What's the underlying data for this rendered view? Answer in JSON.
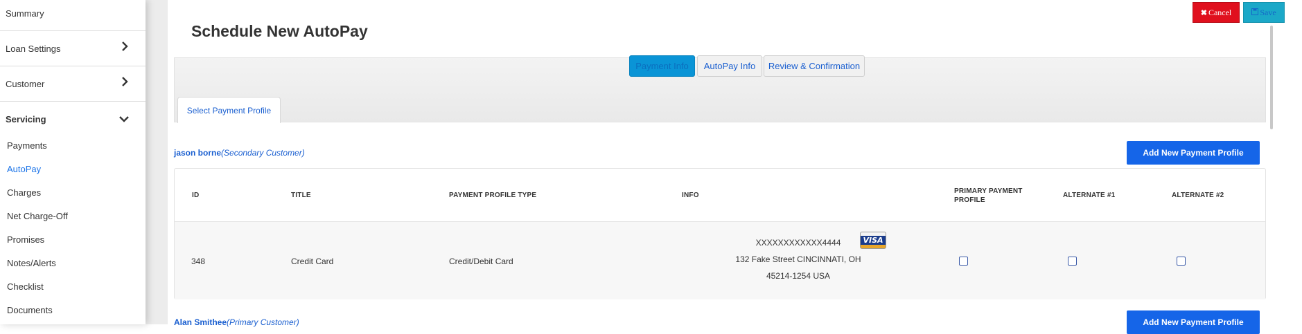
{
  "sidebar": {
    "summary": "Summary",
    "loan_settings": "Loan Settings",
    "customer": "Customer",
    "servicing": "Servicing",
    "items": [
      "Payments",
      "AutoPay",
      "Charges",
      "Net Charge-Off",
      "Promises",
      "Notes/Alerts",
      "Checklist",
      "Documents"
    ],
    "active_item": "AutoPay"
  },
  "header": {
    "title": "Schedule New AutoPay",
    "cancel_label": "Cancel",
    "save_label": "Save"
  },
  "wizard": {
    "steps": [
      "Payment Info",
      "AutoPay Info",
      "Review & Confirmation"
    ],
    "active_step": "Payment Info",
    "tab_label": "Select Payment Profile"
  },
  "customers": [
    {
      "name": "jason borne",
      "role": "(Secondary Customer)",
      "add_button": "Add New Payment Profile",
      "columns": [
        "ID",
        "TITLE",
        "PAYMENT PROFILE TYPE",
        "INFO",
        "PRIMARY PAYMENT PROFILE",
        "ALTERNATE #1",
        "ALTERNATE #2"
      ],
      "rows": [
        {
          "id": "348",
          "title": "Credit Card",
          "type": "Credit/Debit Card",
          "info_number": "XXXXXXXXXXXX4444",
          "info_address_1": "132 Fake Street CINCINNATI, OH",
          "info_address_2": "45214-1254 USA",
          "card_brand": "VISA",
          "primary_checked": false,
          "alt1_checked": false,
          "alt2_checked": false
        }
      ]
    },
    {
      "name": "Alan Smithee",
      "role": "(Primary Customer)",
      "add_button": "Add New Payment Profile"
    }
  ],
  "colors": {
    "accent": "#1565e8",
    "cancel": "#e0101e",
    "save": "#1ba8c8",
    "step_active": "#0a94d6"
  }
}
